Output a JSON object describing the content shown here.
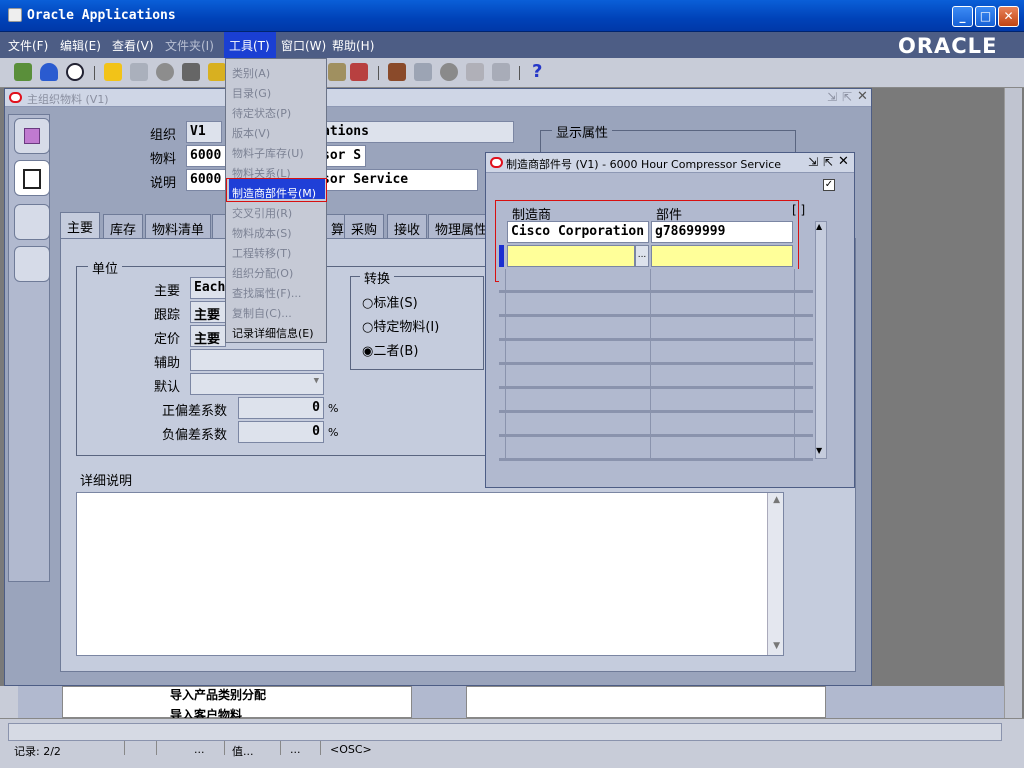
{
  "window": {
    "title": "Oracle Applications",
    "min": "_",
    "max": "□",
    "close": "✕"
  },
  "menubar": {
    "items": [
      "文件(F)",
      "编辑(E)",
      "查看(V)",
      "文件夹(I)",
      "工具(T)",
      "窗口(W)",
      "帮助(H)"
    ],
    "logo": "ORACLE"
  },
  "master": {
    "title": "主组织物料 (V1)",
    "org_label": "组织",
    "org_code": "V1",
    "org_name": "ations",
    "item_label": "物料",
    "item_value": "6000",
    "item_tail": "sor S",
    "desc_label": "说明",
    "desc_value": "6000",
    "desc_tail": "sor Service",
    "display_attrs": "显示属性",
    "tabs": [
      "主要",
      "库存",
      "物料清单",
      "算",
      "采购",
      "接收",
      "物理属性"
    ],
    "unit_group": "单位",
    "primary_label": "主要",
    "primary_value": "Each",
    "track_label": "跟踪",
    "track_value": "主要",
    "price_label": "定价",
    "price_value": "主要",
    "secondary_label": "辅助",
    "default_label": "默认",
    "pos_dev_label": "正偏差系数",
    "pos_dev_value": "0",
    "pct": "%",
    "neg_dev_label": "负偏差系数",
    "neg_dev_value": "0",
    "convert_group": "转换",
    "conv_options": [
      "标准(S)",
      "特定物料(I)",
      "二者(B)"
    ],
    "detail_label": "详细说明"
  },
  "tools_menu": {
    "items": [
      "类别(A)",
      "目录(G)",
      "待定状态(P)",
      "版本(V)",
      "物料子库存(U)",
      "物料关系(L)",
      "制造商部件号(M)",
      "交叉引用(R)",
      "物料成本(S)",
      "工程转移(T)",
      "组织分配(O)",
      "查找属性(F)...",
      "复制自(C)...",
      "记录详细信息(E)"
    ]
  },
  "dialog": {
    "title": "制造商部件号 (V1) - 6000 Hour Compressor Service",
    "col_mfr": "制造商",
    "col_part": "部件",
    "bracket": "[ ]",
    "rows": [
      {
        "mfr": "Cisco Corporation",
        "part": "g78699999"
      },
      {
        "mfr": "",
        "part": ""
      }
    ],
    "lov": "..."
  },
  "background": {
    "line1": "导入产品类别分配",
    "line2": "导入客户物料"
  },
  "status": {
    "record": "记录: 2/2",
    "s1": "...",
    "s2": "值...",
    "s3": "...",
    "s4": "<OSC>"
  }
}
